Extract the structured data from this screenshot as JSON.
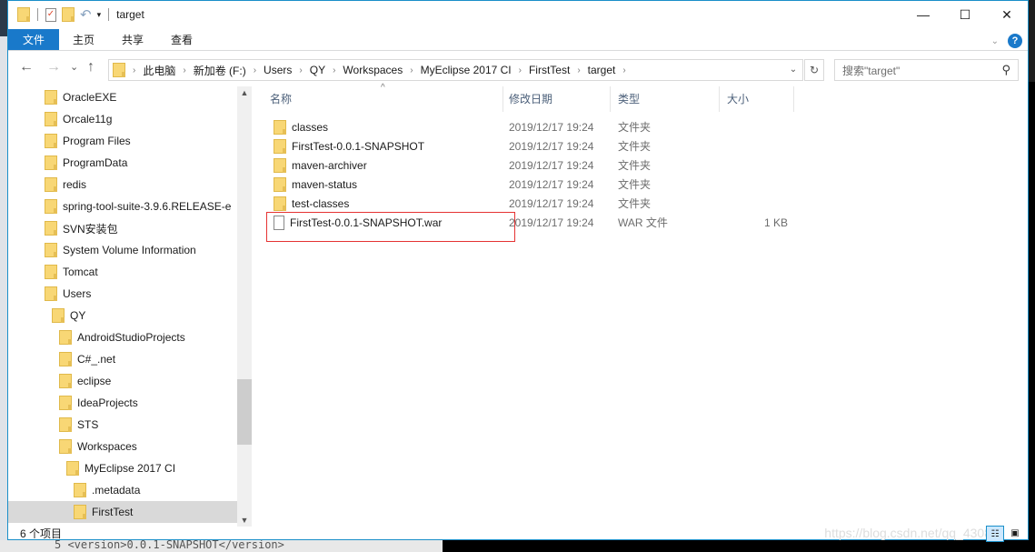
{
  "window": {
    "title": "target",
    "controls": {
      "minimize": "—",
      "maximize": "☐",
      "close": "✕"
    }
  },
  "ribbon": {
    "tabs": [
      {
        "label": "文件",
        "active": true
      },
      {
        "label": "主页"
      },
      {
        "label": "共享"
      },
      {
        "label": "查看"
      }
    ],
    "help": "?"
  },
  "nav": {
    "back": "←",
    "forward": "→",
    "recent": "⌄",
    "up": "↑",
    "breadcrumbs": [
      "此电脑",
      "新加卷 (F:)",
      "Users",
      "QY",
      "Workspaces",
      "MyEclipse 2017 CI",
      "FirstTest",
      "target"
    ],
    "refresh": "↻",
    "search_placeholder": "搜索\"target\""
  },
  "tree": {
    "items": [
      {
        "label": "OracleEXE",
        "level": 0
      },
      {
        "label": "Orcale11g",
        "level": 0
      },
      {
        "label": "Program Files",
        "level": 0
      },
      {
        "label": "ProgramData",
        "level": 0
      },
      {
        "label": "redis",
        "level": 0
      },
      {
        "label": "spring-tool-suite-3.9.6.RELEASE-e",
        "level": 0
      },
      {
        "label": "SVN安装包",
        "level": 0
      },
      {
        "label": "System Volume Information",
        "level": 0
      },
      {
        "label": "Tomcat",
        "level": 0
      },
      {
        "label": "Users",
        "level": 0
      },
      {
        "label": "QY",
        "level": 1
      },
      {
        "label": "AndroidStudioProjects",
        "level": 2
      },
      {
        "label": "C#_.net",
        "level": 2
      },
      {
        "label": "eclipse",
        "level": 2
      },
      {
        "label": "IdeaProjects",
        "level": 2
      },
      {
        "label": "STS",
        "level": 2
      },
      {
        "label": "Workspaces",
        "level": 2
      },
      {
        "label": "MyEclipse 2017 CI",
        "level": 3
      },
      {
        "label": ".metadata",
        "level": 4
      },
      {
        "label": "FirstTest",
        "level": 4,
        "selected": true
      }
    ]
  },
  "columns": {
    "name": "名称",
    "date": "修改日期",
    "type": "类型",
    "size": "大小"
  },
  "files": [
    {
      "name": "classes",
      "date": "2019/12/17 19:24",
      "type": "文件夹",
      "size": "",
      "kind": "folder"
    },
    {
      "name": "FirstTest-0.0.1-SNAPSHOT",
      "date": "2019/12/17 19:24",
      "type": "文件夹",
      "size": "",
      "kind": "folder"
    },
    {
      "name": "maven-archiver",
      "date": "2019/12/17 19:24",
      "type": "文件夹",
      "size": "",
      "kind": "folder"
    },
    {
      "name": "maven-status",
      "date": "2019/12/17 19:24",
      "type": "文件夹",
      "size": "",
      "kind": "folder"
    },
    {
      "name": "test-classes",
      "date": "2019/12/17 19:24",
      "type": "文件夹",
      "size": "",
      "kind": "folder"
    },
    {
      "name": "FirstTest-0.0.1-SNAPSHOT.war",
      "date": "2019/12/17 19:24",
      "type": "WAR 文件",
      "size": "1 KB",
      "kind": "file"
    }
  ],
  "status": {
    "count": "6 个项目"
  },
  "watermark": "https://blog.csdn.net/qq_4308",
  "background": {
    "code_line": "5    <version>0.0.1-SNAPSHOT</version>"
  }
}
